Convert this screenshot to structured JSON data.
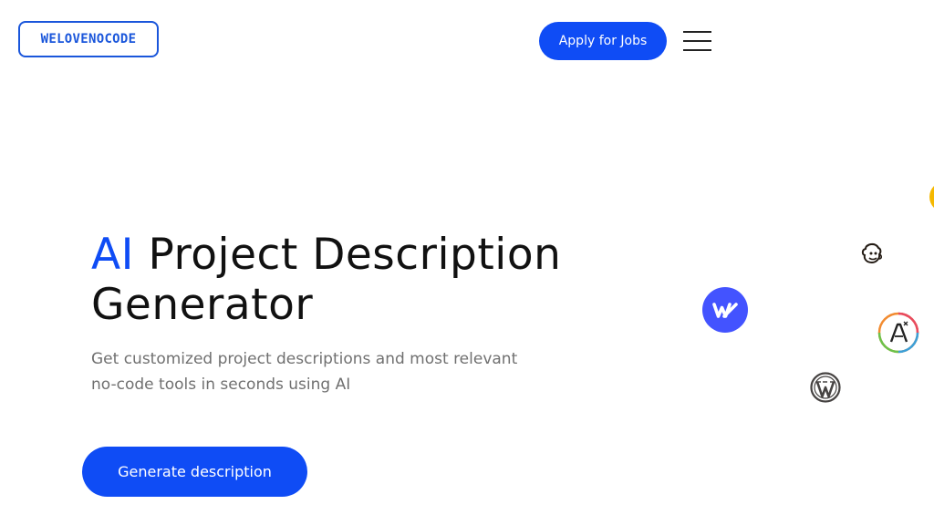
{
  "header": {
    "logo_text": "WELOVENOCODE",
    "apply_label": "Apply for Jobs",
    "menu_icon": "hamburger-menu-icon"
  },
  "hero": {
    "title_accent": "AI",
    "title_rest": " Project Description Generator",
    "subtitle": "Get customized project descriptions and most relevant no-code tools in seconds using AI",
    "cta_label": "Generate description"
  },
  "tools": [
    {
      "name": "webflow-icon",
      "color": "#4353ff"
    },
    {
      "name": "mailchimp-icon",
      "color": "#241c15"
    },
    {
      "name": "codesigner-icon",
      "color": "#e8a33d"
    },
    {
      "name": "wordpress-icon",
      "color": "#464342"
    },
    {
      "name": "yellow-tool-icon",
      "color": "#f5b800"
    }
  ],
  "colors": {
    "accent": "#0f4cf5",
    "logo_border": "#1a56db",
    "title_text": "#111111",
    "subtitle_text": "#707070",
    "background": "#ffffff"
  }
}
